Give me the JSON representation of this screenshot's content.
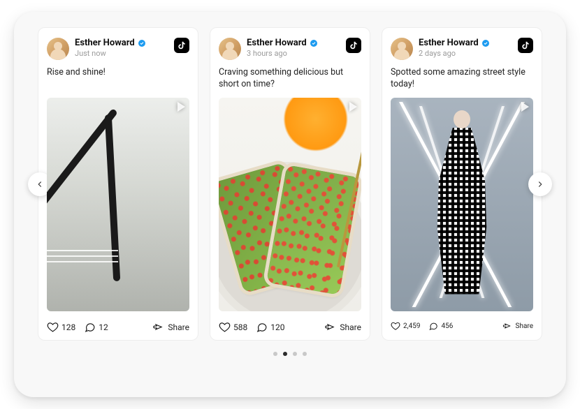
{
  "author": {
    "name": "Esther Howard",
    "verified": true
  },
  "platform": "tiktok-icon",
  "share_label": "Share",
  "posts": [
    {
      "timestamp": "Just now",
      "caption": "Rise and shine!",
      "likes": "128",
      "comments": "12"
    },
    {
      "timestamp": "3 hours ago",
      "caption": "Craving something delicious but short on time?",
      "likes": "588",
      "comments": "120"
    },
    {
      "timestamp": "2 days ago",
      "caption": "Spotted some amazing street style today!",
      "likes": "2,459",
      "comments": "456"
    }
  ],
  "pagination": {
    "total": 4,
    "active_index": 1
  }
}
